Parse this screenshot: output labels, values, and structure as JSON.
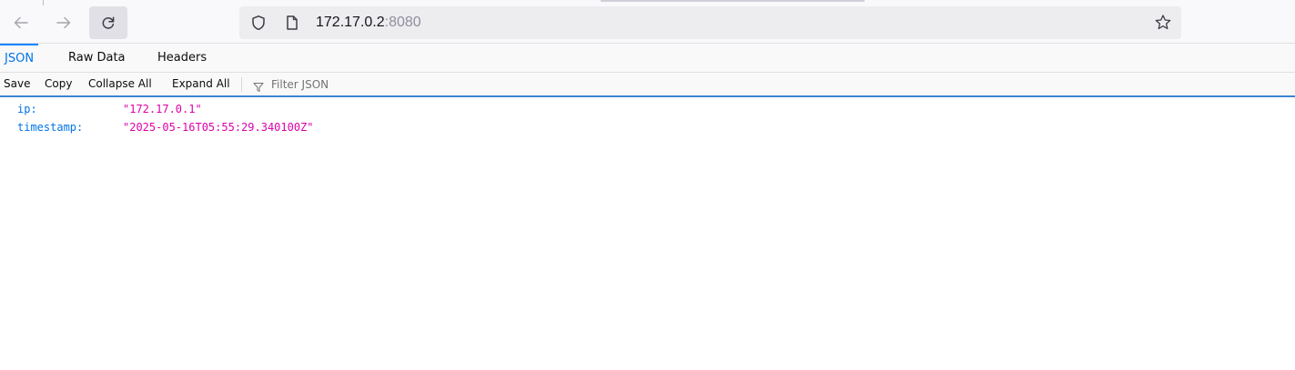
{
  "browser": {
    "url_host": "172.17.0.2",
    "url_port": ":8080",
    "icons": [
      "back-arrow-icon",
      "forward-arrow-icon",
      "reload-icon",
      "shield-icon",
      "page-icon",
      "star-icon"
    ]
  },
  "viewer": {
    "tabs": [
      {
        "label": "JSON",
        "selected": true
      },
      {
        "label": "Raw Data",
        "selected": false
      },
      {
        "label": "Headers",
        "selected": false
      }
    ],
    "actions": {
      "save": "Save",
      "copy": "Copy",
      "collapse_all": "Collapse All",
      "expand_all": "Expand All"
    },
    "filter": {
      "placeholder": "Filter JSON",
      "value": ""
    }
  },
  "json": {
    "rows": [
      {
        "key": "ip:",
        "value": "\"172.17.0.1\""
      },
      {
        "key": "timestamp:",
        "value": "\"2025-05-16T05:55:29.340100Z\""
      }
    ]
  },
  "colors": {
    "selected_tab": "#0074e8",
    "json_key": "#0074e8",
    "json_string": "#dd00a9",
    "toolbar_accent": "#3a86d1"
  }
}
